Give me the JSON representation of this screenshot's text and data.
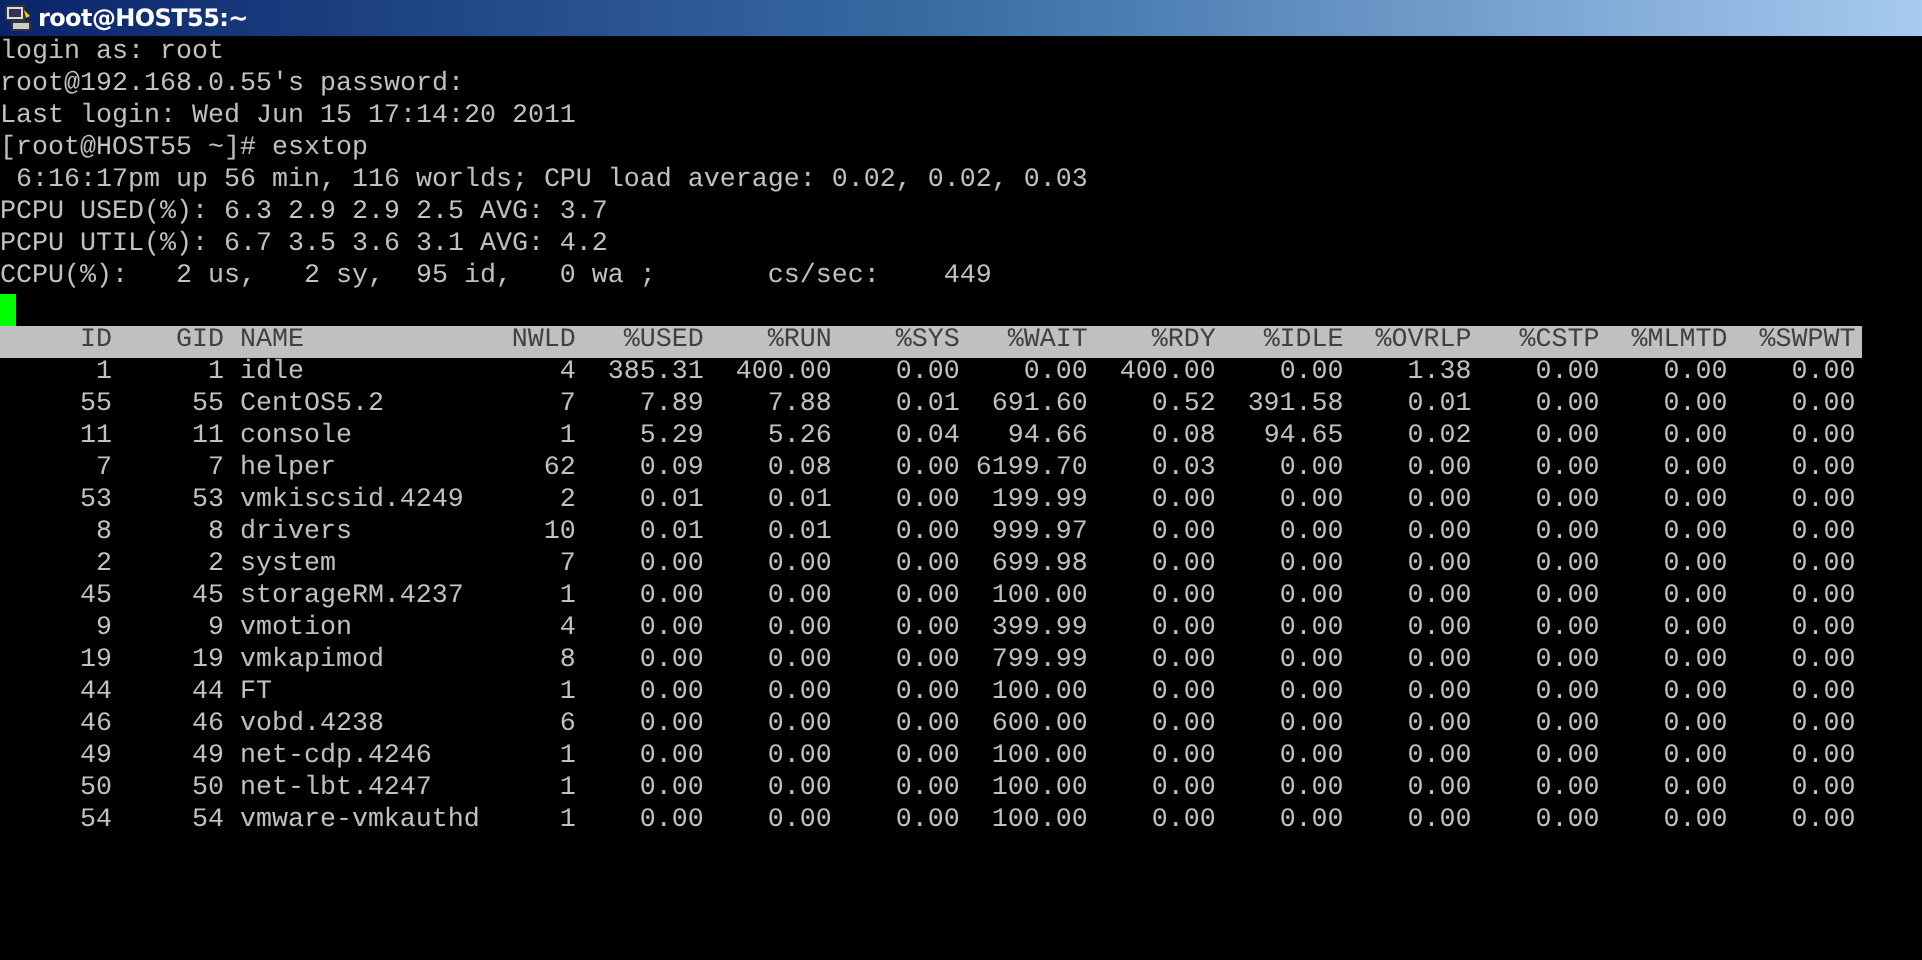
{
  "window": {
    "title": "root@HOST55:~"
  },
  "terminal": {
    "lines": [
      "login as: root",
      "root@192.168.0.55's password:",
      "Last login: Wed Jun 15 17:14:20 2011",
      "[root@HOST55 ~]# esxtop",
      " 6:16:17pm up 56 min, 116 worlds; CPU load average: 0.02, 0.02, 0.03",
      "PCPU USED(%): 6.3 2.9 2.9 2.5 AVG: 3.7",
      "PCPU UTIL(%): 6.7 3.5 3.6 3.1 AVG: 4.2",
      "CCPU(%):   2 us,   2 sy,  95 id,   0 wa ;       cs/sec:    449"
    ]
  },
  "table": {
    "columns": [
      "ID",
      "GID",
      "NAME",
      "NWLD",
      "%USED",
      "%RUN",
      "%SYS",
      "%WAIT",
      "%RDY",
      "%IDLE",
      "%OVRLP",
      "%CSTP",
      "%MLMTD",
      "%SWPWT"
    ],
    "rows": [
      [
        "1",
        "1",
        "idle",
        "4",
        "385.31",
        "400.00",
        "0.00",
        "0.00",
        "400.00",
        "0.00",
        "1.38",
        "0.00",
        "0.00",
        "0.00"
      ],
      [
        "55",
        "55",
        "CentOS5.2",
        "7",
        "7.89",
        "7.88",
        "0.01",
        "691.60",
        "0.52",
        "391.58",
        "0.01",
        "0.00",
        "0.00",
        "0.00"
      ],
      [
        "11",
        "11",
        "console",
        "1",
        "5.29",
        "5.26",
        "0.04",
        "94.66",
        "0.08",
        "94.65",
        "0.02",
        "0.00",
        "0.00",
        "0.00"
      ],
      [
        "7",
        "7",
        "helper",
        "62",
        "0.09",
        "0.08",
        "0.00",
        "6199.70",
        "0.03",
        "0.00",
        "0.00",
        "0.00",
        "0.00",
        "0.00"
      ],
      [
        "53",
        "53",
        "vmkiscsid.4249",
        "2",
        "0.01",
        "0.01",
        "0.00",
        "199.99",
        "0.00",
        "0.00",
        "0.00",
        "0.00",
        "0.00",
        "0.00"
      ],
      [
        "8",
        "8",
        "drivers",
        "10",
        "0.01",
        "0.01",
        "0.00",
        "999.97",
        "0.00",
        "0.00",
        "0.00",
        "0.00",
        "0.00",
        "0.00"
      ],
      [
        "2",
        "2",
        "system",
        "7",
        "0.00",
        "0.00",
        "0.00",
        "699.98",
        "0.00",
        "0.00",
        "0.00",
        "0.00",
        "0.00",
        "0.00"
      ],
      [
        "45",
        "45",
        "storageRM.4237",
        "1",
        "0.00",
        "0.00",
        "0.00",
        "100.00",
        "0.00",
        "0.00",
        "0.00",
        "0.00",
        "0.00",
        "0.00"
      ],
      [
        "9",
        "9",
        "vmotion",
        "4",
        "0.00",
        "0.00",
        "0.00",
        "399.99",
        "0.00",
        "0.00",
        "0.00",
        "0.00",
        "0.00",
        "0.00"
      ],
      [
        "19",
        "19",
        "vmkapimod",
        "8",
        "0.00",
        "0.00",
        "0.00",
        "799.99",
        "0.00",
        "0.00",
        "0.00",
        "0.00",
        "0.00",
        "0.00"
      ],
      [
        "44",
        "44",
        "FT",
        "1",
        "0.00",
        "0.00",
        "0.00",
        "100.00",
        "0.00",
        "0.00",
        "0.00",
        "0.00",
        "0.00",
        "0.00"
      ],
      [
        "46",
        "46",
        "vobd.4238",
        "6",
        "0.00",
        "0.00",
        "0.00",
        "600.00",
        "0.00",
        "0.00",
        "0.00",
        "0.00",
        "0.00",
        "0.00"
      ],
      [
        "49",
        "49",
        "net-cdp.4246",
        "1",
        "0.00",
        "0.00",
        "0.00",
        "100.00",
        "0.00",
        "0.00",
        "0.00",
        "0.00",
        "0.00",
        "0.00"
      ],
      [
        "50",
        "50",
        "net-lbt.4247",
        "1",
        "0.00",
        "0.00",
        "0.00",
        "100.00",
        "0.00",
        "0.00",
        "0.00",
        "0.00",
        "0.00",
        "0.00"
      ],
      [
        "54",
        "54",
        "vmware-vmkauthd",
        "1",
        "0.00",
        "0.00",
        "0.00",
        "100.00",
        "0.00",
        "0.00",
        "0.00",
        "0.00",
        "0.00",
        "0.00"
      ]
    ]
  }
}
